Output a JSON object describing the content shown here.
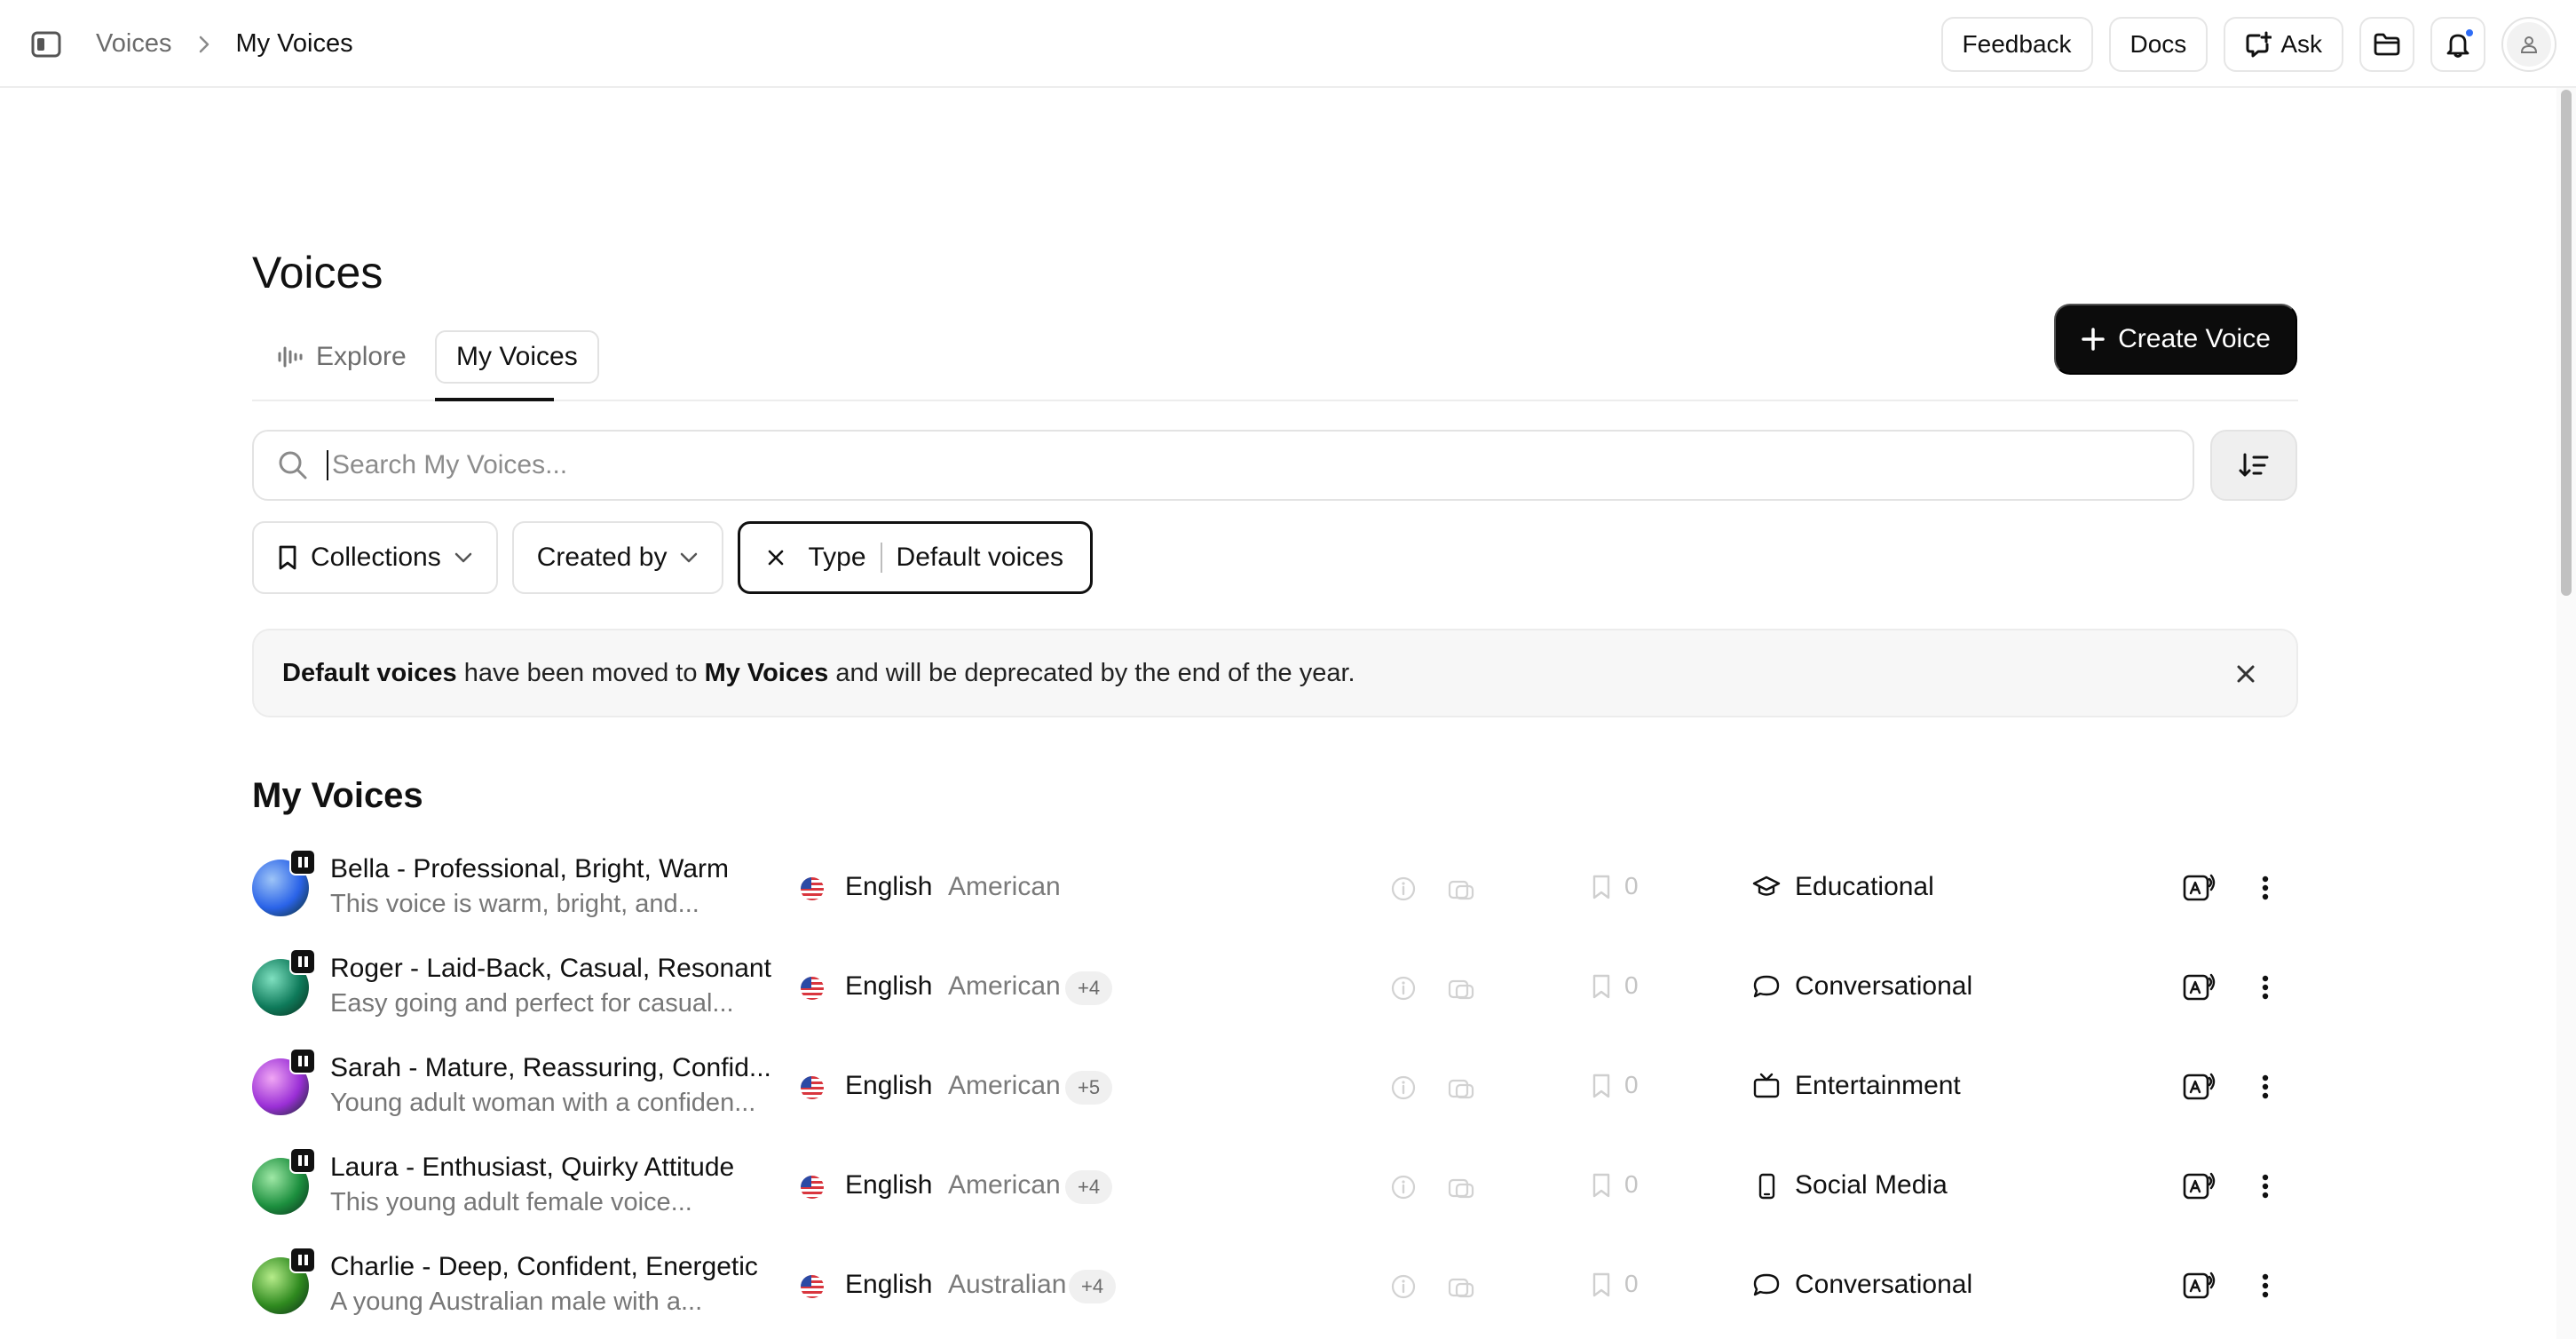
{
  "breadcrumb": {
    "root": "Voices",
    "current": "My Voices"
  },
  "topbar": {
    "feedback": "Feedback",
    "docs": "Docs",
    "ask": "Ask"
  },
  "page": {
    "title": "Voices"
  },
  "tabs": [
    {
      "label": "Explore"
    },
    {
      "label": "My Voices",
      "active": true
    }
  ],
  "create_button": "Create Voice",
  "search": {
    "placeholder": "Search My Voices...",
    "value": ""
  },
  "filters": {
    "collections": "Collections",
    "created_by": "Created by",
    "active_filter": {
      "key": "Type",
      "value": "Default voices"
    }
  },
  "banner": {
    "part1": "Default voices",
    "part2": " have been moved to ",
    "part3": "My Voices",
    "part4": " and will be deprecated by the end of the year."
  },
  "section_title": "My Voices",
  "voices": [
    {
      "name": "Bella - Professional, Bright, Warm",
      "description": "This voice is warm, bright, and...",
      "language": "English",
      "accent": "American",
      "more": "",
      "saves": "0",
      "category": "Educational",
      "category_icon": "graduation-cap-icon",
      "avatar_colors": [
        "#2a63e8",
        "#9dc4f7"
      ]
    },
    {
      "name": "Roger - Laid-Back, Casual, Resonant",
      "description": "Easy going and perfect for casual...",
      "language": "English",
      "accent": "American",
      "more": "+4",
      "saves": "0",
      "category": "Conversational",
      "category_icon": "speech-bubble-icon",
      "avatar_colors": [
        "#0e7a5a",
        "#7fe0c0"
      ]
    },
    {
      "name": "Sarah - Mature, Reassuring, Confid...",
      "description": "Young adult woman with a confiden...",
      "language": "English",
      "accent": "American",
      "more": "+5",
      "saves": "0",
      "category": "Entertainment",
      "category_icon": "tv-icon",
      "avatar_colors": [
        "#9a2fd6",
        "#f0a6f4"
      ]
    },
    {
      "name": "Laura - Enthusiast, Quirky Attitude",
      "description": "This young adult female voice...",
      "language": "English",
      "accent": "American",
      "more": "+4",
      "saves": "0",
      "category": "Social Media",
      "category_icon": "phone-icon",
      "avatar_colors": [
        "#1c8f3e",
        "#9fe8a6"
      ]
    },
    {
      "name": "Charlie - Deep, Confident, Energetic",
      "description": "A young Australian male with a...",
      "language": "English",
      "accent": "Australian",
      "more": "+4",
      "saves": "0",
      "category": "Conversational",
      "category_icon": "speech-bubble-icon",
      "avatar_colors": [
        "#2f8a1f",
        "#b6ec8a"
      ]
    }
  ],
  "colors": {
    "primary": "#0c0c0c",
    "accent_blue": "#2f6df6",
    "muted_text": "#777777"
  }
}
